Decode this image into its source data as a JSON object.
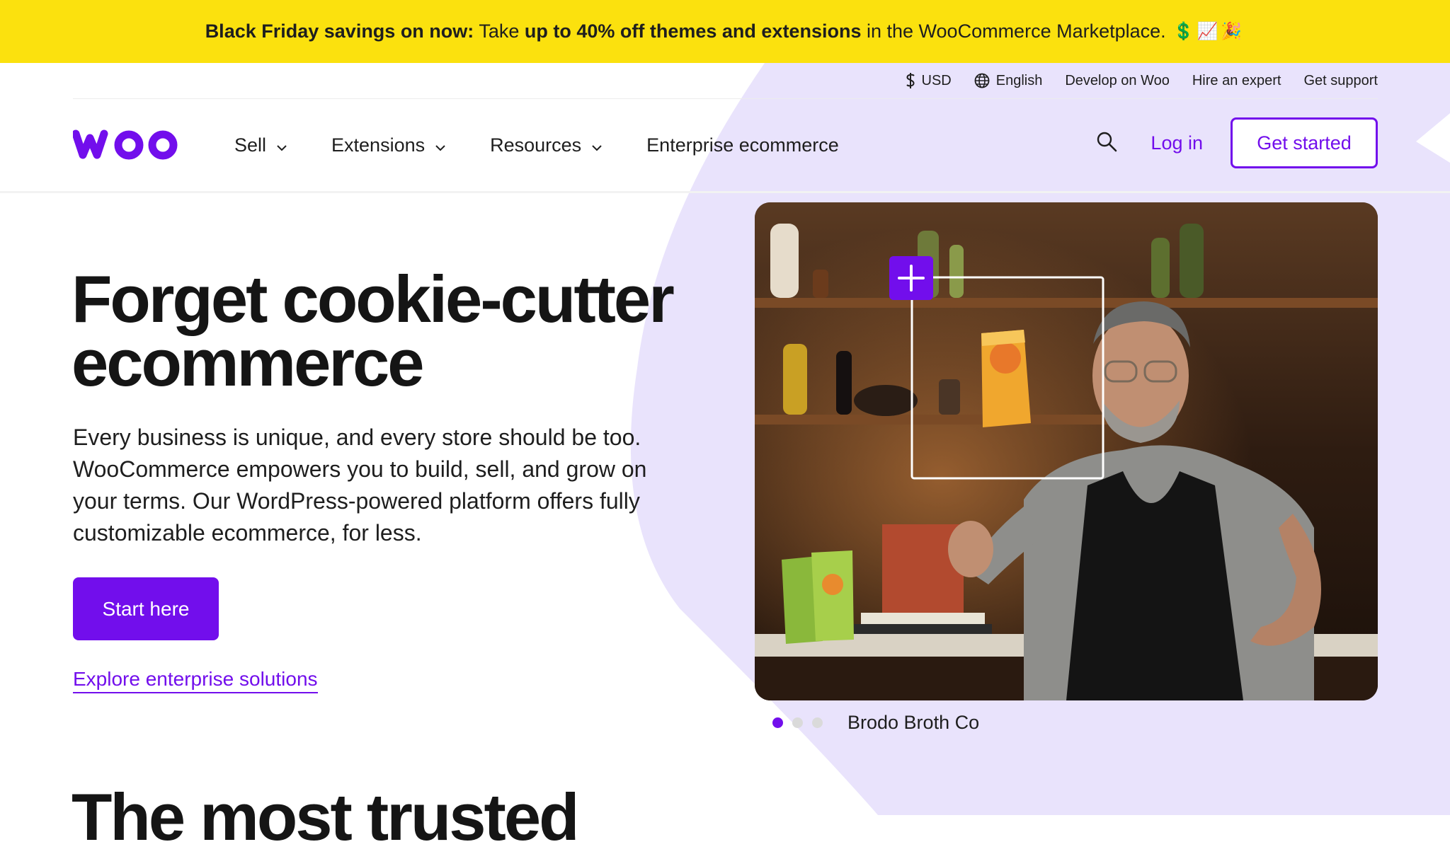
{
  "banner": {
    "bold_lead": "Black Friday savings on now:",
    "text_1": "Take",
    "bold_offer": "up to 40% off themes and extensions",
    "text_2": "in the WooCommerce Marketplace.",
    "emoji": "💲📈🎉"
  },
  "utility_nav": {
    "currency": "USD",
    "language": "English",
    "links": [
      "Develop on Woo",
      "Hire an expert",
      "Get support"
    ]
  },
  "nav": {
    "items": [
      "Sell",
      "Extensions",
      "Resources",
      "Enterprise ecommerce"
    ],
    "login": "Log in",
    "get_started": "Get started"
  },
  "hero": {
    "title_line1": "Forget cookie-cutter",
    "title_line2": "ecommerce",
    "body": "Every business is unique, and every store should be too. WooCommerce empowers you to build, sell, and grow on your terms. Our WordPress-powered platform offers fully customizable ecommerce, for less.",
    "cta_primary": "Start here",
    "cta_secondary": "Explore enterprise solutions"
  },
  "carousel": {
    "caption": "Brodo Broth Co",
    "active_index": 0,
    "total": 3
  },
  "next_section": {
    "heading": "The most trusted"
  },
  "colors": {
    "banner": "#fbe10e",
    "brand_purple": "#720eec",
    "blob": "#e9e3fc"
  }
}
